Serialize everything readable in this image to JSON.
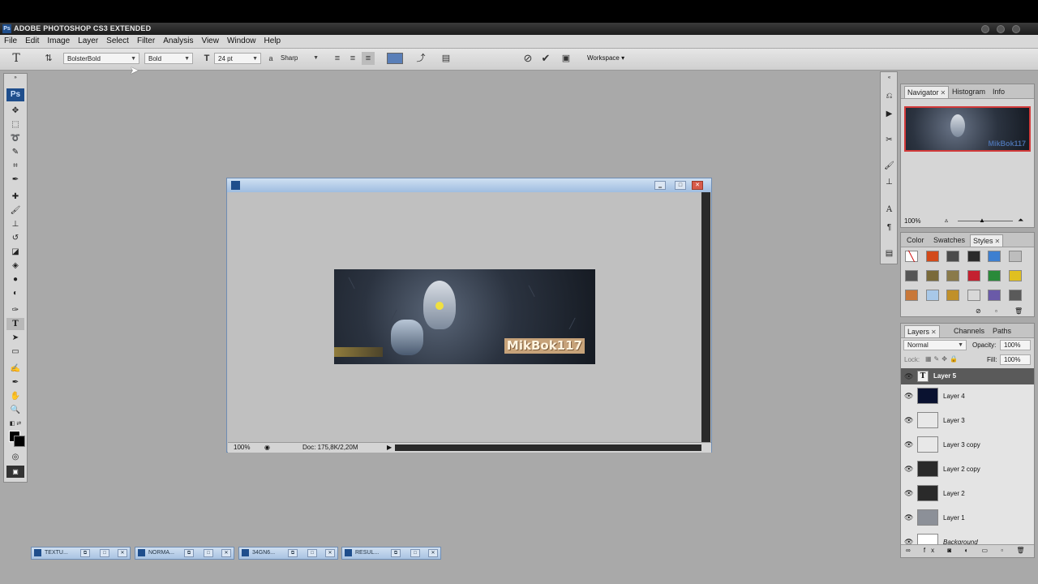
{
  "app": {
    "title": "ADOBE PHOTOSHOP CS3 EXTENDED",
    "logo": "Ps"
  },
  "menu": [
    "File",
    "Edit",
    "Image",
    "Layer",
    "Select",
    "Filter",
    "Analysis",
    "View",
    "Window",
    "Help"
  ],
  "options": {
    "font_family": "BolsterBold",
    "font_style": "Bold",
    "font_size": "24 pt",
    "aa_label": "a",
    "antialias": "Sharp",
    "workspace": "Workspace ▾",
    "text_color": "#5a7fb8"
  },
  "document": {
    "zoom": "100%",
    "doc_info": "Doc: 175,8K/2,20M",
    "banner_text": "MikBok117"
  },
  "navigator": {
    "tabs": [
      "Navigator",
      "Histogram",
      "Info"
    ],
    "zoom": "100%",
    "thumb_text": "MikBok117"
  },
  "styles_panel": {
    "tabs": [
      "Color",
      "Swatches",
      "Styles"
    ],
    "swatch_colors": [
      "#ffffff",
      "#d24a1a",
      "#4a4a4a",
      "#2a2a2a",
      "#3d7fd0",
      "#bdbdbd",
      "#555555",
      "#7a6a3a",
      "#8a7a4a",
      "#c42030",
      "#2a8a3a",
      "#e0c020",
      "#c8783a",
      "#a8c8e8",
      "#c0902a",
      "#d8d8d8",
      "#6a5aa8",
      "#5a5a5a"
    ]
  },
  "layers_panel": {
    "tabs": [
      "Layers",
      "Channels",
      "Paths"
    ],
    "blend_mode": "Normal",
    "opacity_label": "Opacity:",
    "opacity": "100%",
    "lock_label": "Lock:",
    "fill_label": "Fill:",
    "fill": "100%",
    "layers": [
      {
        "name": "Layer 5",
        "thumb": "#f2f2f2",
        "selected": true
      },
      {
        "name": "Layer 4",
        "thumb": "#0a1230",
        "selected": false
      },
      {
        "name": "Layer 3",
        "thumb": "#e8e8e8",
        "selected": false
      },
      {
        "name": "Layer 3 copy",
        "thumb": "#e8e8e8",
        "selected": false
      },
      {
        "name": "Layer 2 copy",
        "thumb": "#2a2a2a",
        "selected": false
      },
      {
        "name": "Layer 2",
        "thumb": "#2a2a2a",
        "selected": false
      },
      {
        "name": "Layer 1",
        "thumb": "#8c9098",
        "selected": false
      },
      {
        "name": "Background",
        "thumb": "#ffffff",
        "selected": false
      }
    ]
  },
  "minimized_docs": [
    "TEXTU...",
    "NORMA...",
    "34GN6...",
    "RESUL..."
  ]
}
